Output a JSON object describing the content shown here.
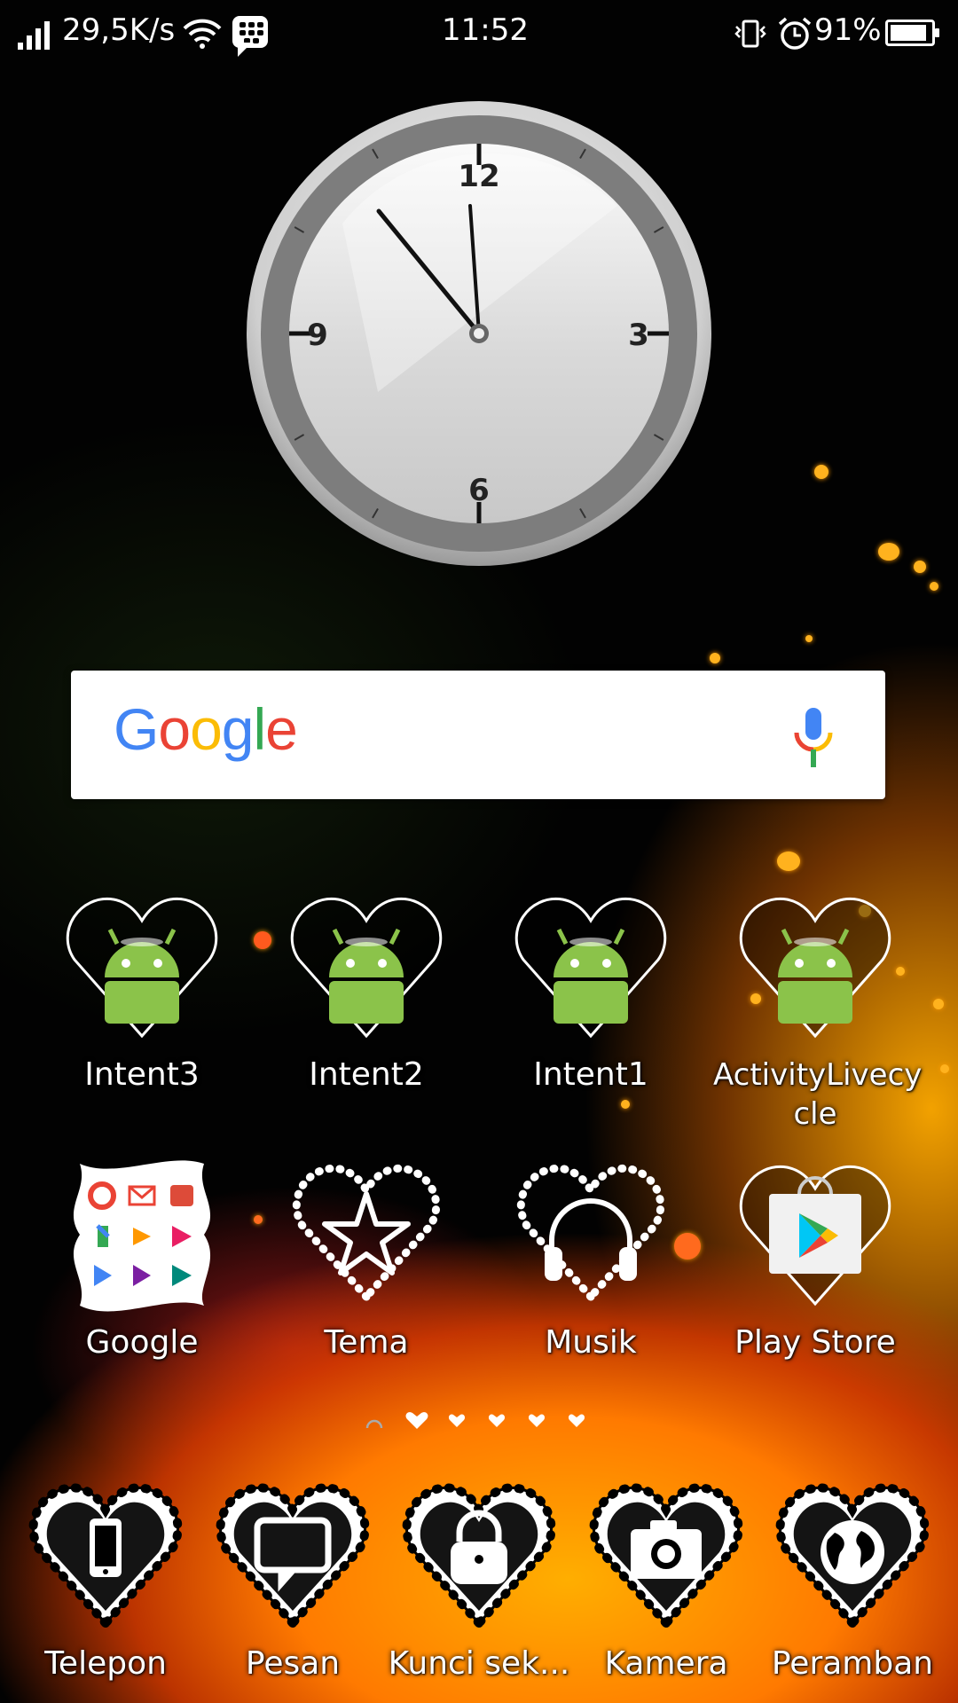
{
  "status_bar": {
    "network_speed": "29,5K/s",
    "time": "11:52",
    "battery": "91%",
    "icons": [
      "signal-icon",
      "wifi-icon",
      "bbm-icon",
      "vibrate-icon",
      "alarm-icon",
      "battery-icon"
    ]
  },
  "clock_widget": {
    "numerals": {
      "n12": "12",
      "n3": "3",
      "n6": "6",
      "n9": "9"
    },
    "time_shown": "11:52"
  },
  "search_widget": {
    "logo": "Google",
    "icons": [
      "google-logo",
      "mic-icon"
    ]
  },
  "apps": [
    {
      "label": "Intent3",
      "icon": "android-icon"
    },
    {
      "label": "Intent2",
      "icon": "android-icon"
    },
    {
      "label": "Intent1",
      "icon": "android-icon"
    },
    {
      "label": "ActivityLivecycle",
      "label_line1": "ActivityLivecy",
      "label_line2": "cle",
      "icon": "android-icon"
    },
    {
      "label": "Google",
      "icon": "google-folder-icon"
    },
    {
      "label": "Tema",
      "icon": "star-icon"
    },
    {
      "label": "Musik",
      "icon": "headphones-icon"
    },
    {
      "label": "Play Store",
      "icon": "play-store-icon"
    }
  ],
  "page_indicator": {
    "pages": 6,
    "current": 1
  },
  "dock": [
    {
      "label": "Telepon",
      "icon": "phone-icon"
    },
    {
      "label": "Pesan",
      "icon": "message-icon"
    },
    {
      "label": "Kunci sek...",
      "icon": "lock-icon"
    },
    {
      "label": "Kamera",
      "icon": "camera-icon"
    },
    {
      "label": "Peramban",
      "icon": "globe-icon"
    }
  ],
  "colors": {
    "google_blue": "#4285F4",
    "google_red": "#EA4335",
    "google_yellow": "#FBBC05",
    "google_green": "#34A853",
    "android_green": "#8BC34A",
    "wallpaper_orange": "#FF8C00"
  }
}
